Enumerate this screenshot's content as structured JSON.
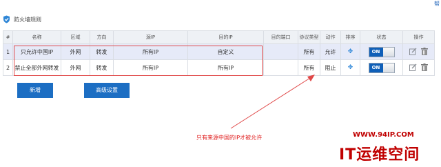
{
  "help_link": "帮",
  "panel": {
    "title": "防火墙规则"
  },
  "table": {
    "headers": [
      "#",
      "名称",
      "区域",
      "方向",
      "源IP",
      "目的IP",
      "目的端口",
      "协议类型",
      "动作",
      "排序",
      "状态",
      "操作"
    ],
    "rows": [
      {
        "index": "1",
        "name": "只允许中国IP",
        "zone": "外网",
        "direction": "转发",
        "src_ip": "所有IP",
        "dst_ip": "自定义",
        "dst_port": "",
        "protocol": "所有",
        "action": "允许",
        "status": "ON"
      },
      {
        "index": "2",
        "name": "禁止全部外网转发",
        "zone": "外网",
        "direction": "转发",
        "src_ip": "所有IP",
        "dst_ip": "所有IP",
        "dst_port": "",
        "protocol": "所有",
        "action": "阻止",
        "status": "ON"
      }
    ]
  },
  "buttons": {
    "add": "新增",
    "advanced": "高级设置"
  },
  "annotation": "只有来源中国的IP才被允许",
  "watermark": {
    "url": "WWW.94IP.COM",
    "brand": "IT运维空间"
  },
  "colors": {
    "accent": "#1c6ec3",
    "annotation": "#e02020",
    "highlight_row": "#e6eaf8"
  },
  "icons": [
    "shield-icon",
    "sort-icon",
    "edit-icon",
    "delete-icon"
  ]
}
